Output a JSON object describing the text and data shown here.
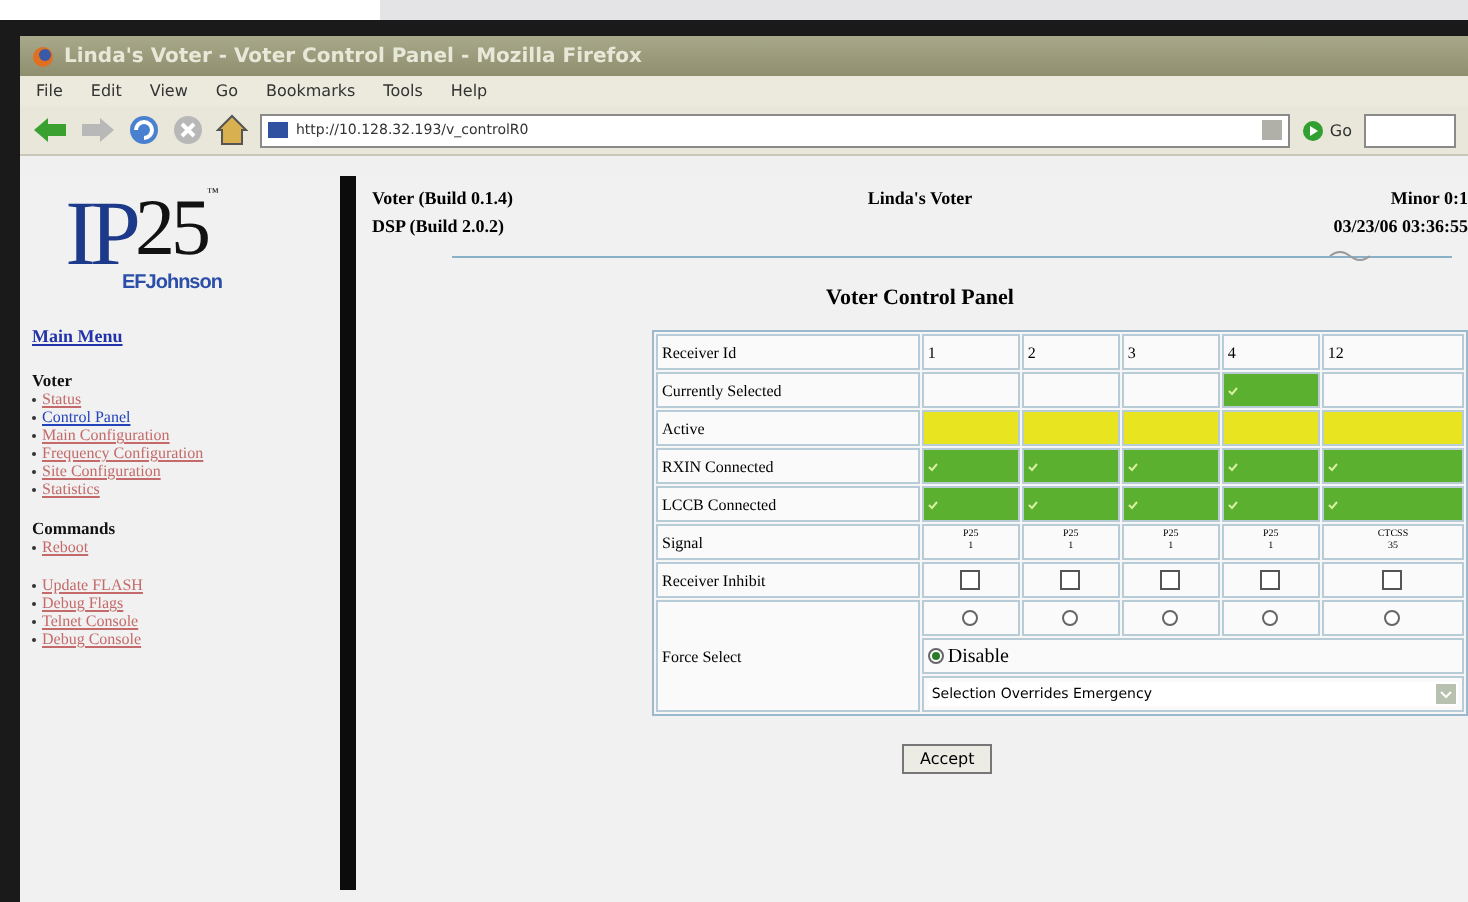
{
  "window": {
    "title": "Linda's Voter - Voter Control Panel - Mozilla Firefox"
  },
  "menu": [
    "File",
    "Edit",
    "View",
    "Go",
    "Bookmarks",
    "Tools",
    "Help"
  ],
  "toolbar": {
    "url": "http://10.128.32.193/v_controlR0",
    "go": "Go"
  },
  "sidebar": {
    "logo": {
      "letters": "IP",
      "number": "25",
      "trademark": "™",
      "brand": "EFJohnson"
    },
    "main_menu": "Main Menu",
    "sections": [
      {
        "title": "Voter",
        "items": [
          {
            "label": "Status",
            "selected": false
          },
          {
            "label": "Control Panel",
            "selected": true
          },
          {
            "label": "Main Configuration",
            "selected": false
          },
          {
            "label": "Frequency Configuration",
            "selected": false
          },
          {
            "label": "Site Configuration",
            "selected": false
          },
          {
            "label": "Statistics",
            "selected": false
          }
        ]
      },
      {
        "title": "Commands",
        "items": [
          {
            "label": "Reboot",
            "selected": false
          }
        ]
      },
      {
        "items": [
          {
            "label": "Update FLASH",
            "selected": false
          },
          {
            "label": "Debug Flags",
            "selected": false
          },
          {
            "label": "Telnet Console",
            "selected": false
          },
          {
            "label": "Debug Console",
            "selected": false
          }
        ]
      }
    ]
  },
  "header": {
    "left": [
      "Voter (Build 0.1.4)",
      "DSP (Build 2.0.2)"
    ],
    "center": "Linda's Voter",
    "right": [
      "Minor 0:1",
      "03/23/06 03:36:55"
    ]
  },
  "heading": "Voter Control Panel",
  "table": {
    "id_label": "Receiver Id",
    "rows": [
      {
        "kind": "selected",
        "label": "Currently Selected"
      },
      {
        "kind": "active",
        "label": "Active"
      },
      {
        "kind": "rxin",
        "label": "RXIN Connected"
      },
      {
        "kind": "lccb",
        "label": "LCCB Connected"
      },
      {
        "kind": "signal",
        "label": "Signal"
      },
      {
        "kind": "inhibit",
        "label": "Receiver Inhibit"
      },
      {
        "kind": "force",
        "label": "Force Select"
      }
    ],
    "receivers": [
      {
        "number": "1",
        "selected": false,
        "active": true,
        "rxin": true,
        "lccb": true,
        "signal": [
          "P25",
          "1"
        ],
        "inhibit": false,
        "force": false
      },
      {
        "number": "2",
        "selected": false,
        "active": true,
        "rxin": true,
        "lccb": true,
        "signal": [
          "P25",
          "1"
        ],
        "inhibit": false,
        "force": false
      },
      {
        "number": "3",
        "selected": false,
        "active": true,
        "rxin": true,
        "lccb": true,
        "signal": [
          "P25",
          "1"
        ],
        "inhibit": false,
        "force": false
      },
      {
        "number": "4",
        "selected": true,
        "active": true,
        "rxin": true,
        "lccb": true,
        "signal": [
          "P25",
          "1"
        ],
        "inhibit": false,
        "force": false
      },
      {
        "number": "12",
        "selected": false,
        "active": true,
        "rxin": true,
        "lccb": true,
        "signal": [
          "CTCSS",
          "35"
        ],
        "inhibit": false,
        "force": false
      }
    ],
    "disable": {
      "label": "Disable",
      "selected": true
    },
    "mode": {
      "value": "Selection Overrides Emergency"
    }
  },
  "accept": "Accept"
}
